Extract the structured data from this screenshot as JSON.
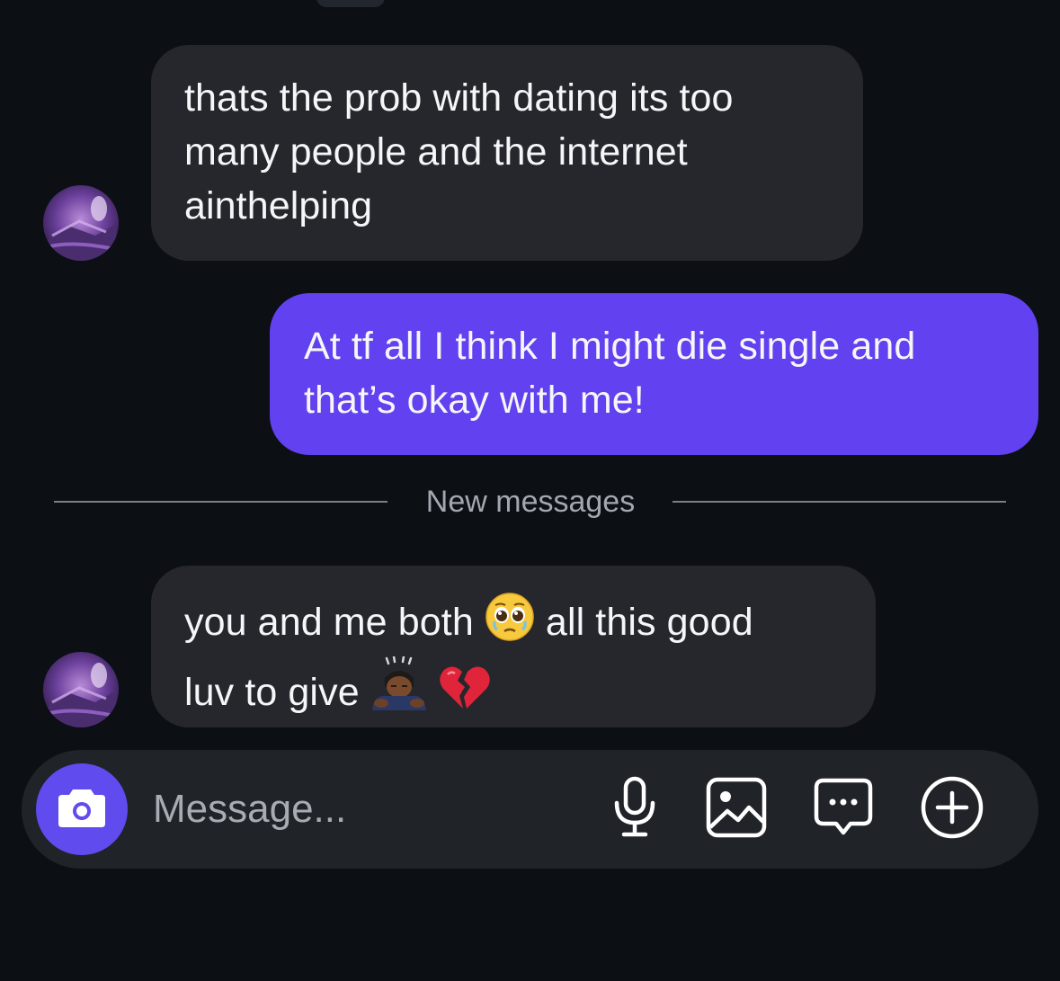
{
  "colors": {
    "background": "#0c0f14",
    "incoming_bubble": "#25272c",
    "outgoing_bubble": "#6241f0",
    "camera_button": "#5f4bee",
    "composer": "#202328",
    "divider": "#7b7f87"
  },
  "messages": [
    {
      "direction": "incoming",
      "lines": [
        "thats the prob with dating its too",
        "many people and the internet",
        "ainthelping"
      ]
    },
    {
      "direction": "outgoing",
      "lines": [
        "At tf all I think I might die single and",
        "that’s okay with me!"
      ]
    },
    {
      "direction": "incoming",
      "line1_before_emoji": "you and me both ",
      "line1_emoji": "pleading-face",
      "line1_after_emoji": " all this good",
      "line2_text": "luv to give ",
      "line2_emojis": [
        "person-bowing-dark-skin",
        "broken-heart"
      ]
    }
  ],
  "divider": {
    "label": "New messages"
  },
  "composer": {
    "placeholder": "Message...",
    "icons": [
      "camera-icon",
      "microphone-icon",
      "image-gallery-icon",
      "sticker-chat-icon",
      "plus-circle-icon"
    ]
  }
}
